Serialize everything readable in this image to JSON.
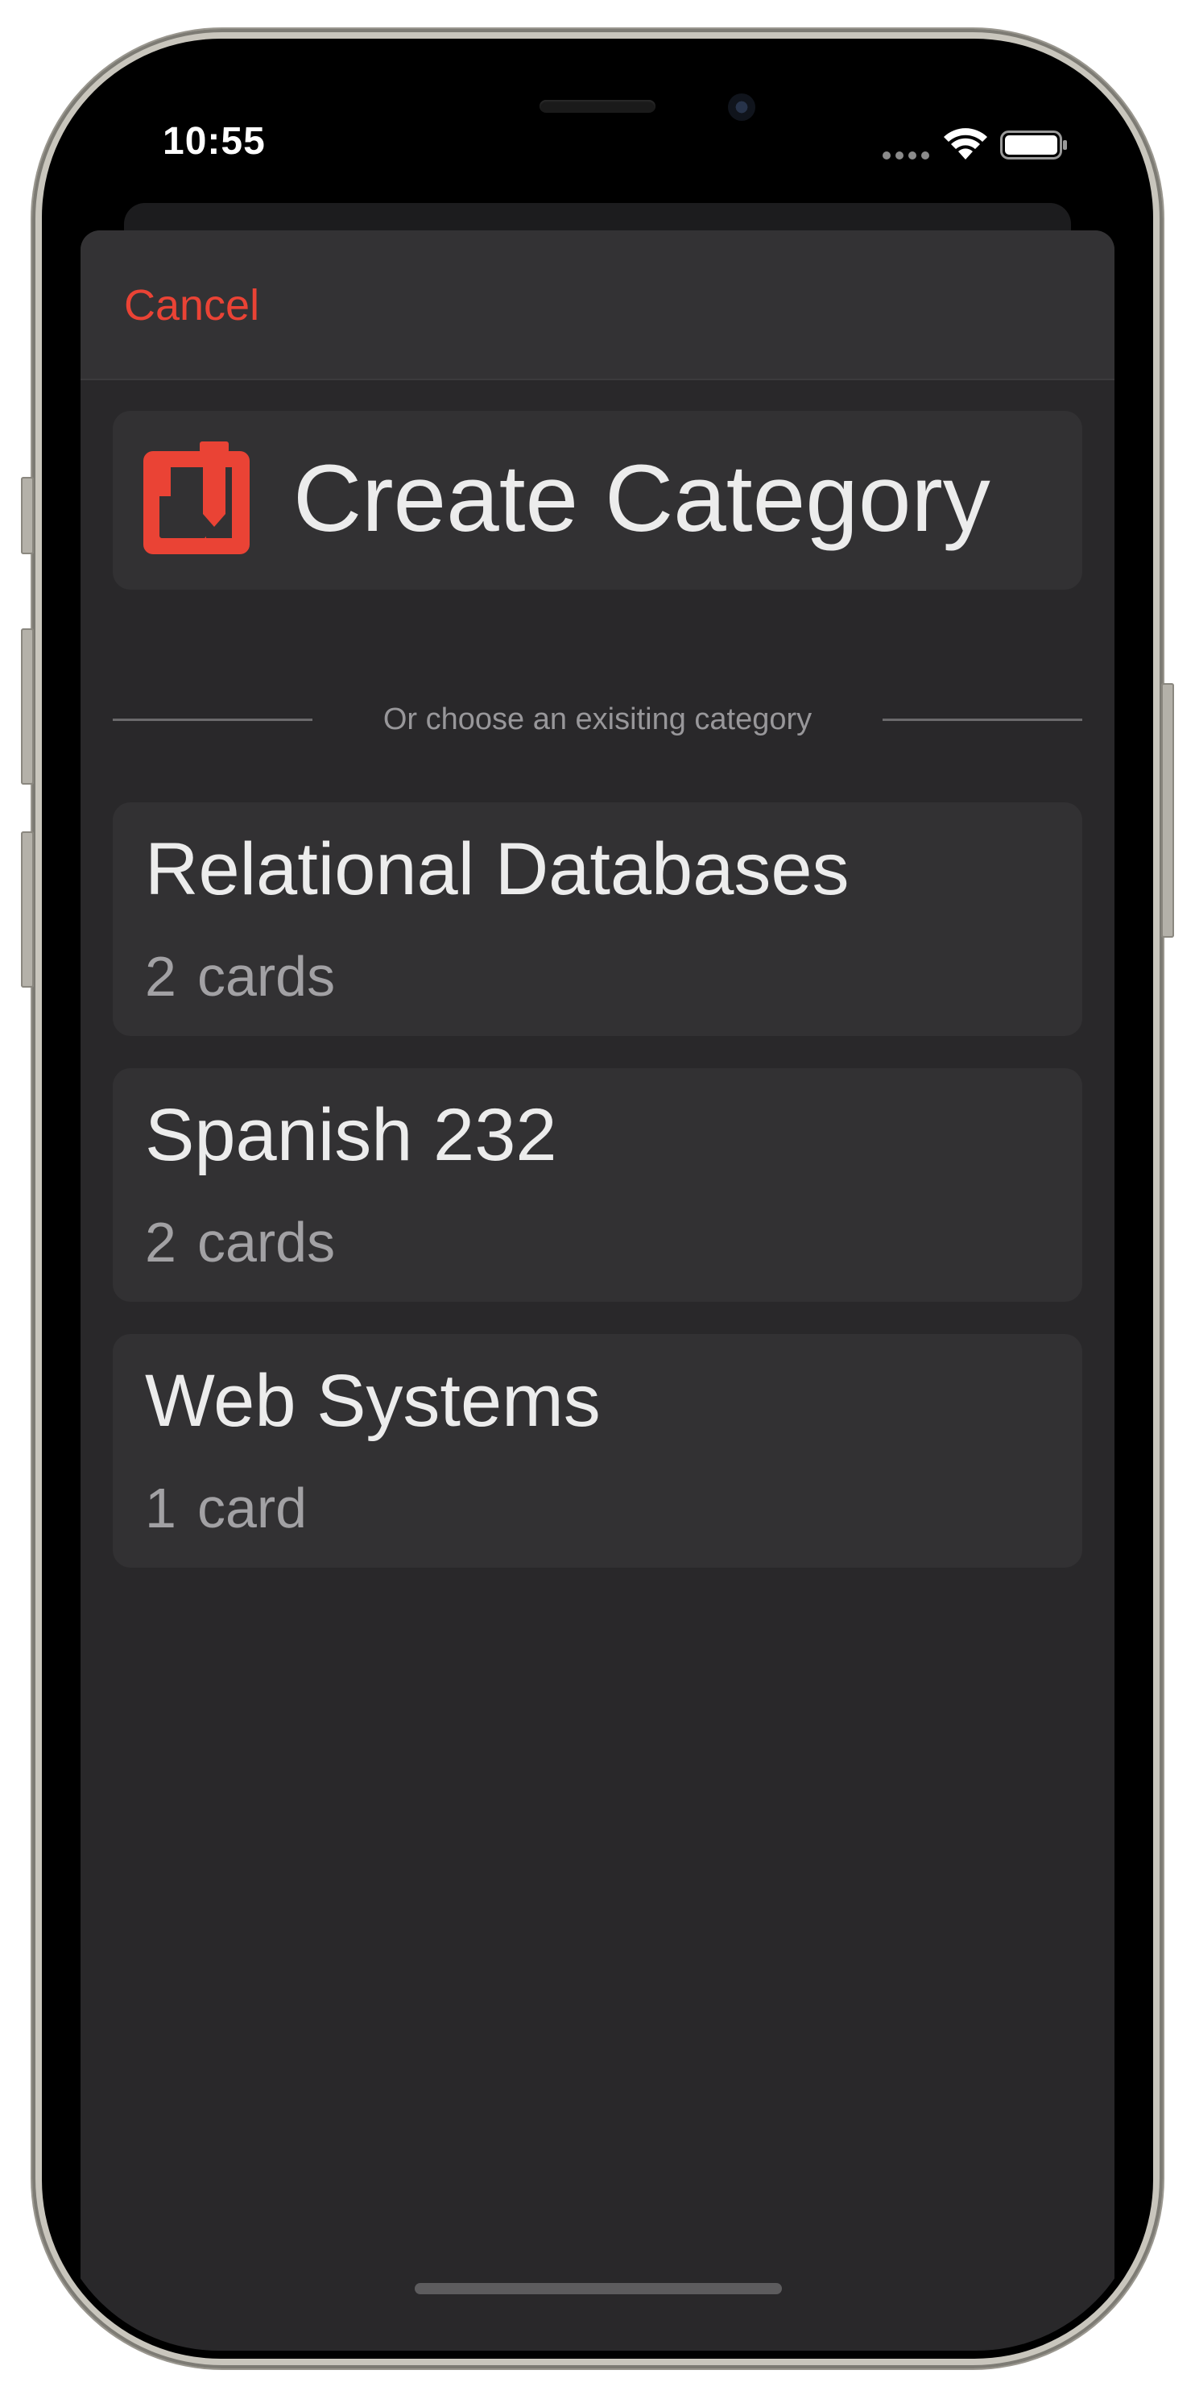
{
  "status_bar": {
    "time": "10:55"
  },
  "nav": {
    "cancel_label": "Cancel"
  },
  "create": {
    "title": "Create Category",
    "icon": "notebook-pen-icon",
    "icon_color": "#ea4335"
  },
  "divider": {
    "text": "Or choose an exisiting category"
  },
  "categories": [
    {
      "name": "Relational Databases",
      "count": "2",
      "unit": "cards"
    },
    {
      "name": "Spanish 232",
      "count": "2",
      "unit": "cards"
    },
    {
      "name": "Web Systems",
      "count": "1",
      "unit": "card"
    }
  ],
  "colors": {
    "accent": "#ea4335",
    "sheet_background": "#29282a",
    "card_background": "#323133",
    "primary_text": "#ececec",
    "secondary_text": "#a2a1a4"
  },
  "icons": {
    "wifi": "wifi-icon",
    "battery": "battery-icon",
    "signal": "cellular-signal-icon"
  }
}
